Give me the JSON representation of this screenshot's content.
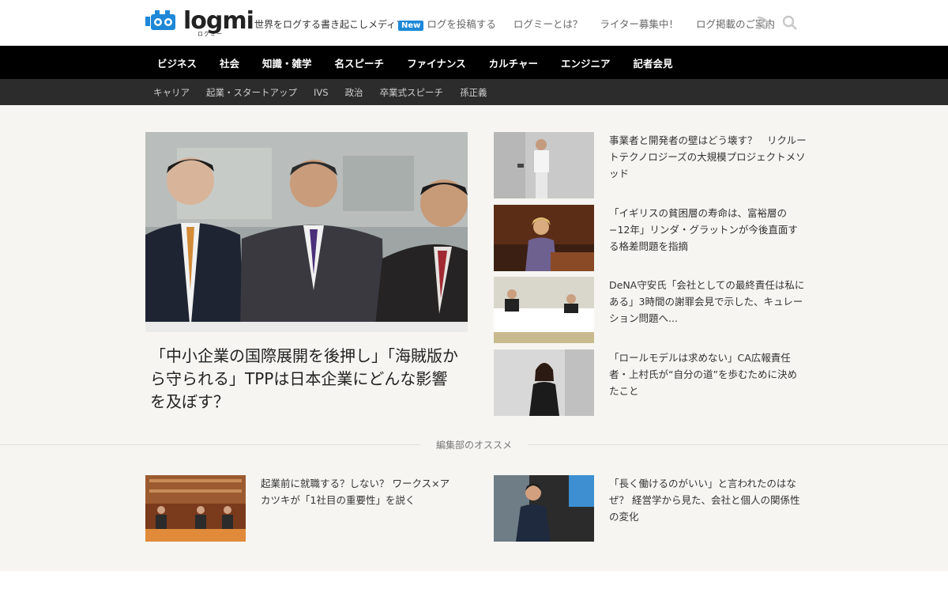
{
  "header": {
    "logo_text": "logmi",
    "logo_kana": "ログミー",
    "tagline": "世界をログする書き起こしメディア",
    "nav": [
      {
        "badge": "New",
        "label": "ログを投稿する"
      },
      {
        "label": "ログミーとは？"
      },
      {
        "label": "ライター募集中！"
      },
      {
        "label": "ログ掲載のご案内"
      }
    ]
  },
  "main_nav": [
    "ビジネス",
    "社会",
    "知識・雑学",
    "名スピーチ",
    "ファイナンス",
    "カルチャー",
    "エンジニア",
    "記者会見"
  ],
  "sub_nav": [
    "キャリア",
    "起業・スタートアップ",
    "IVS",
    "政治",
    "卒業式スピーチ",
    "孫正義"
  ],
  "hero": {
    "title": "「中小企業の国際展開を後押し」「海賊版から守られる」TPPは日本企業にどんな影響を及ぼす？"
  },
  "side_articles": [
    {
      "title": "事業者と開発者の壁はどう壊す？　リクルートテクノロジーズの大規模プロジェクトメソッド"
    },
    {
      "title": "「イギリスの貧困層の寿命は、富裕層の−12年」リンダ・グラットンが今後直面する格差問題を指摘"
    },
    {
      "title": "DeNA守安氏「会社としての最終責任は私にある」3時間の謝罪会見で示した、キュレーション問題へ..."
    },
    {
      "title": "「ロールモデルは求めない」CA広報責任者・上村氏が“自分の道”を歩むために決めたこと"
    }
  ],
  "recommend": {
    "label": "編集部のオススメ",
    "items": [
      {
        "title": "起業前に就職する？しない？ ワークス×アカツキが「1社目の重要性」を説く"
      },
      {
        "title": "「長く働けるのがいい」と言われたのはなぜ？ 経営学から見た、会社と個人の関係性の変化"
      }
    ]
  },
  "colors": {
    "accent": "#1e88d8",
    "nav_bg": "#000000",
    "subnav_bg": "#2c2c2c",
    "page_bg": "#f6f5f1"
  }
}
